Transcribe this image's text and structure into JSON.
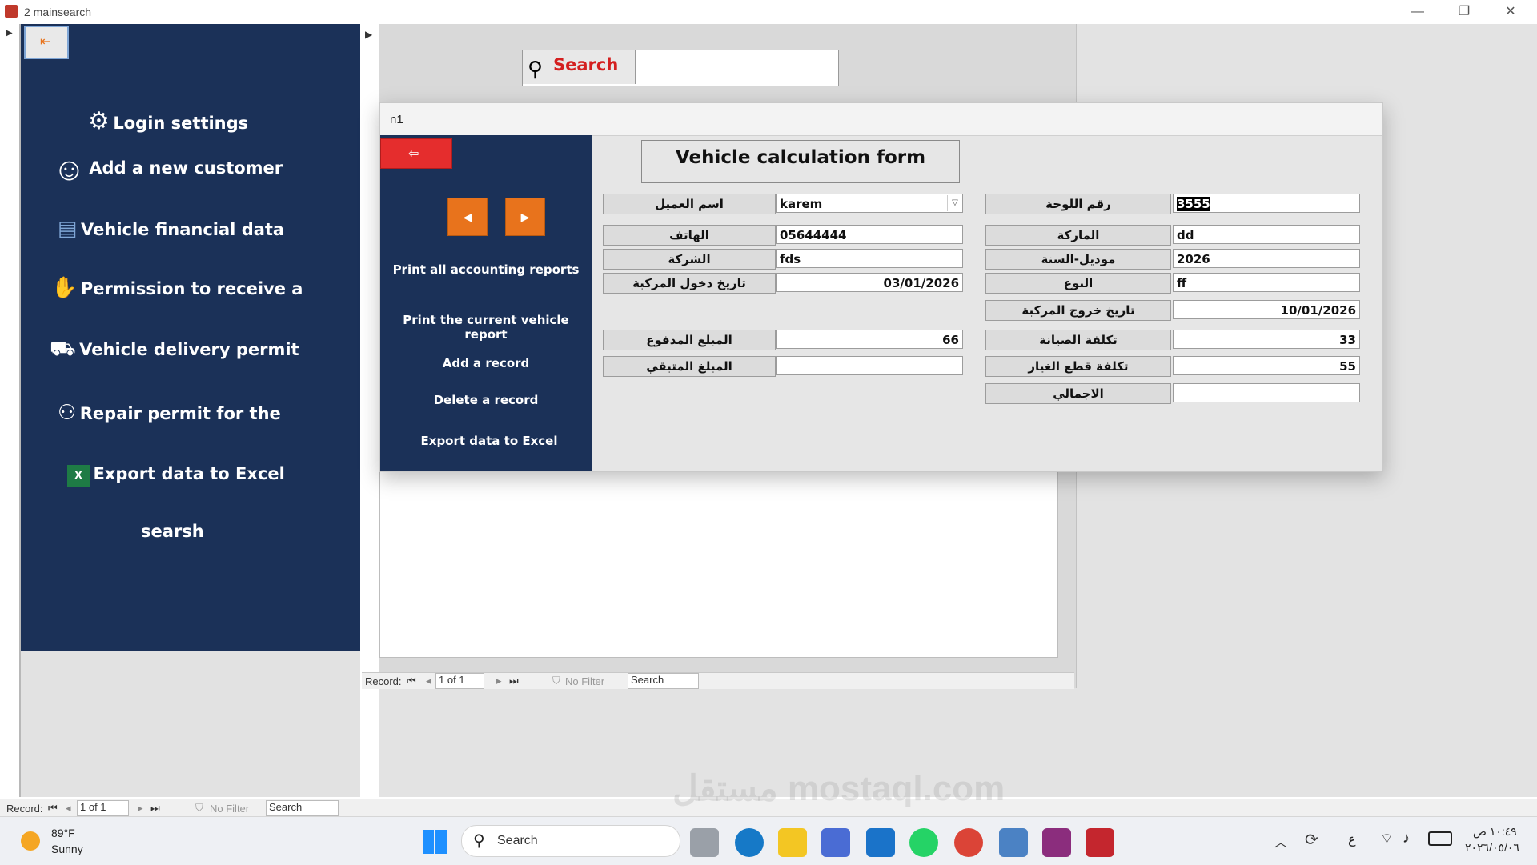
{
  "window": {
    "title": "2 mainsearch",
    "controls": [
      "—",
      "❐",
      "✕"
    ]
  },
  "nav": {
    "items": [
      {
        "label": "Login settings",
        "icon": "gear-icon"
      },
      {
        "label": "Add a new customer",
        "icon": "add-user-icon"
      },
      {
        "label": "Vehicle financial data",
        "icon": "document-icon"
      },
      {
        "label": "Permission to receive a",
        "icon": "hand-icon"
      },
      {
        "label": "Vehicle delivery permit",
        "icon": "truck-icon"
      },
      {
        "label": "Repair permit for the",
        "icon": "mechanic-icon"
      },
      {
        "label": "Export data to Excel",
        "icon": "excel-icon"
      },
      {
        "label": "searsh",
        "icon": ""
      }
    ]
  },
  "search": {
    "label": "Search",
    "value": ""
  },
  "subform_recordbar": {
    "record_label": "Record:",
    "position": "1 of 1",
    "filter": "No Filter",
    "search": "Search"
  },
  "main_recordbar": {
    "record_label": "Record:",
    "position": "1 of 1",
    "filter": "No Filter",
    "search": "Search"
  },
  "dialog": {
    "title": "n1",
    "form_title": "Vehicle calculation form",
    "side_buttons": [
      "Print all accounting reports",
      "Print the current vehicle report",
      "Add a record",
      "Delete a record",
      "Export data to Excel"
    ],
    "left_fields": [
      {
        "label": "اسم العميل",
        "value": "karem",
        "align": "left",
        "dropdown": true
      },
      {
        "label": "الهاتف",
        "value": "05644444",
        "align": "left"
      },
      {
        "label": "الشركة",
        "value": "fds",
        "align": "left"
      },
      {
        "label": "تاريخ دخول المركبة",
        "value": "03/01/2026",
        "align": "right"
      },
      {
        "label": "المبلغ المدفوع",
        "value": "66",
        "align": "right"
      },
      {
        "label": "المبلغ المتبقي",
        "value": "",
        "align": "right"
      }
    ],
    "right_fields": [
      {
        "label": "رقم اللوحة",
        "value": "3555",
        "align": "left"
      },
      {
        "label": "الماركة",
        "value": "dd",
        "align": "left"
      },
      {
        "label": "موديل-السنة",
        "value": "2026",
        "align": "left"
      },
      {
        "label": "النوع",
        "value": "ff",
        "align": "left"
      },
      {
        "label": "تاريخ خروج المركبة",
        "value": "10/01/2026",
        "align": "right"
      },
      {
        "label": "تكلفة الصيانة",
        "value": "33",
        "align": "right"
      },
      {
        "label": "تكلفة قطع الغيار",
        "value": "55",
        "align": "right"
      },
      {
        "label": "الاجمالي",
        "value": "",
        "align": "right"
      }
    ]
  },
  "taskbar": {
    "weather_temp": "89°F",
    "weather_desc": "Sunny",
    "search_label": "Search",
    "lang": "ع",
    "time": "١٠:٤٩ ص",
    "date": "٢٠٢٦/٠٥/٠٦"
  },
  "watermark": "مستقل mostaql.com"
}
